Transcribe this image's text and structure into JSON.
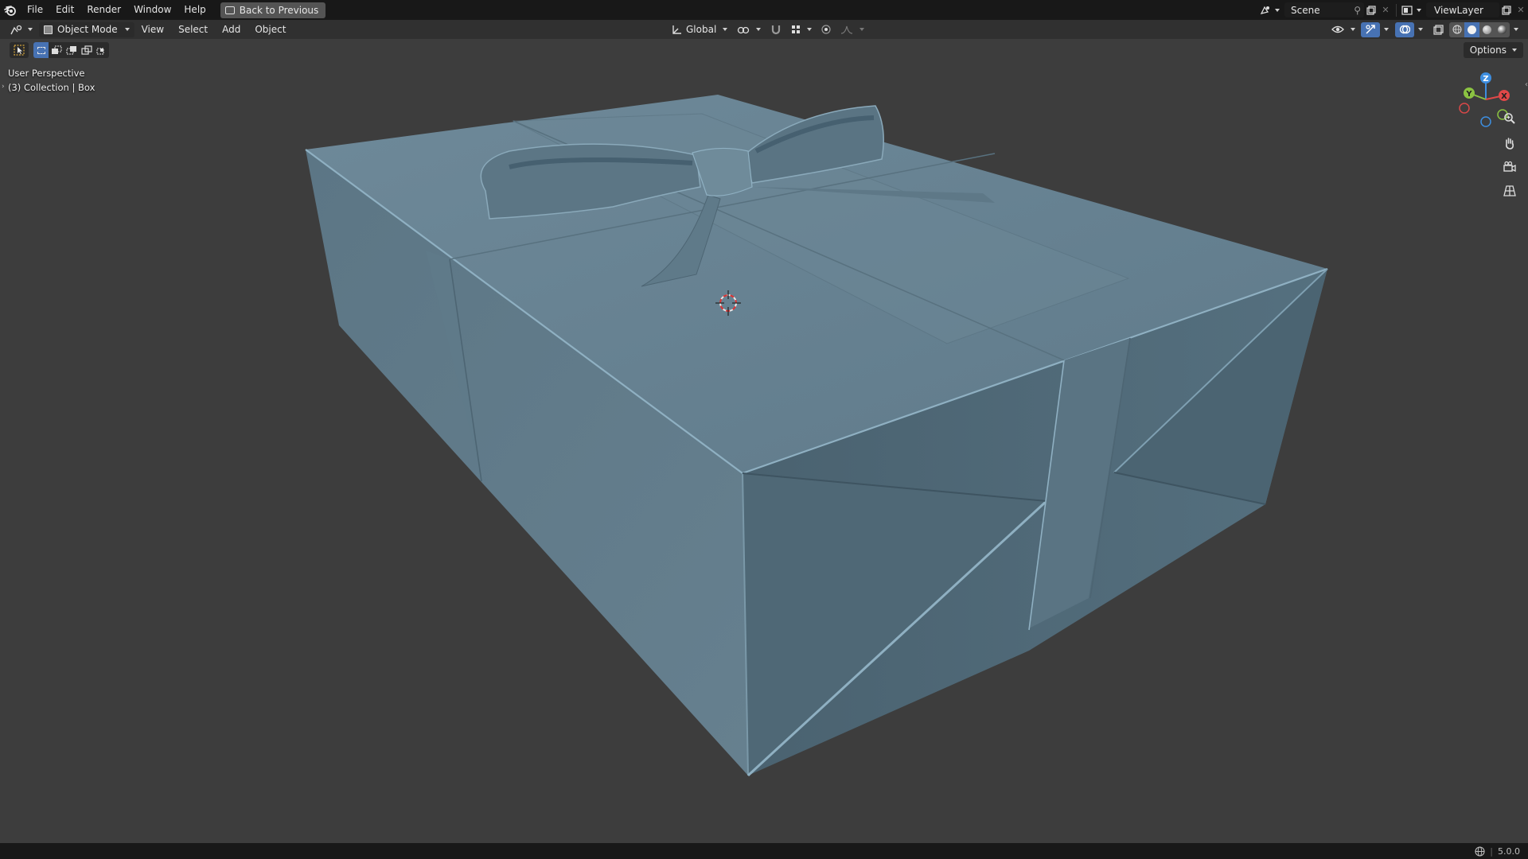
{
  "menu": {
    "items": [
      "File",
      "Edit",
      "Render",
      "Window",
      "Help"
    ],
    "back_button": "Back to Previous"
  },
  "scene": {
    "scene_name": "Scene",
    "view_layer_name": "ViewLayer"
  },
  "header": {
    "mode": "Object Mode",
    "menus": [
      "View",
      "Select",
      "Add",
      "Object"
    ],
    "transform_orientation": "Global"
  },
  "toolbar": {
    "options_label": "Options"
  },
  "viewport": {
    "perspective_label": "User Perspective",
    "collection_label": "(3) Collection | Box",
    "gizmo_axes": [
      "Z",
      "Y",
      "X"
    ],
    "object": "gift-box-with-ribbon-bow",
    "model_color": "#66808f"
  },
  "status": {
    "version": "5.0.0"
  },
  "colors": {
    "accent": "#4772b3",
    "background": "#3d3d3d",
    "topbar": "#181818",
    "header": "#303030",
    "axis_x": "#e04848",
    "axis_y": "#8bc342",
    "axis_z": "#3d8ee0"
  }
}
